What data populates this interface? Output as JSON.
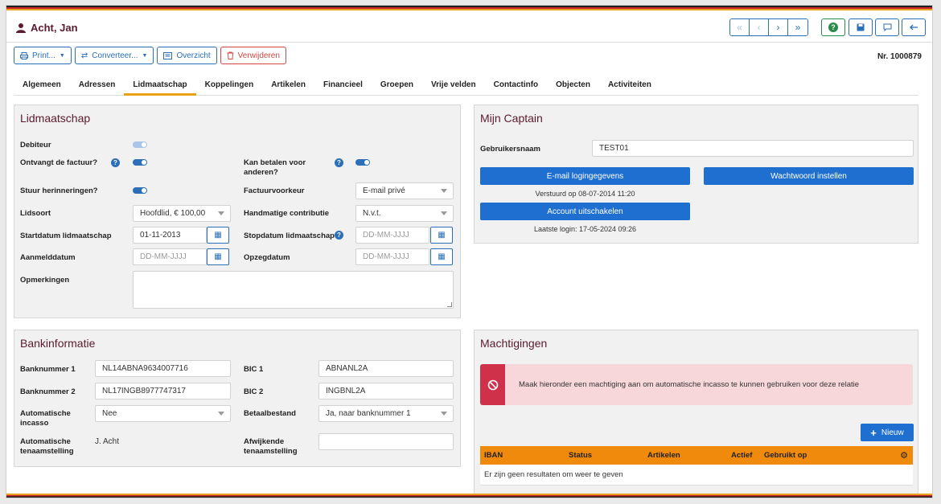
{
  "header": {
    "title": "Acht, Jan",
    "help_icon_label": "?"
  },
  "actions": {
    "print": "Print...",
    "convert": "Converteer...",
    "overview": "Overzicht",
    "delete": "Verwijderen"
  },
  "record_number": "Nr. 1000879",
  "tabs": [
    "Algemeen",
    "Adressen",
    "Lidmaatschap",
    "Koppelingen",
    "Artikelen",
    "Financieel",
    "Groepen",
    "Vrije velden",
    "Contactinfo",
    "Objecten",
    "Activiteiten"
  ],
  "active_tab": "Lidmaatschap",
  "membership": {
    "title": "Lidmaatschap",
    "debiteur": "Debiteur",
    "ontvangt_factuur": "Ontvangt de factuur?",
    "kan_betalen": "Kan betalen voor anderen?",
    "stuur_herinneringen": "Stuur herinneringen?",
    "factuurvoorkeur_label": "Factuurvoorkeur",
    "factuurvoorkeur_value": "E-mail privé",
    "lidsoort_label": "Lidsoort",
    "lidsoort_value": "Hoofdlid, € 100,00",
    "handmatige_label": "Handmatige contributie",
    "handmatige_value": "N.v.t.",
    "startdatum_label": "Startdatum lidmaatschap",
    "startdatum_value": "01-11-2013",
    "stopdatum_label": "Stopdatum lidmaatschap",
    "date_placeholder": "DD-MM-JJJJ",
    "aanmelddatum_label": "Aanmelddatum",
    "opzegdatum_label": "Opzegdatum",
    "opmerkingen_label": "Opmerkingen"
  },
  "captain": {
    "title": "Mijn Captain",
    "username_label": "Gebruikersnaam",
    "username_value": "TEST01",
    "email_btn": "E-mail logingegevens",
    "password_btn": "Wachtwoord instellen",
    "sent_text": "Verstuurd op 08-07-2014 11:20",
    "disable_btn": "Account uitschakelen",
    "last_login": "Laatste login: 17-05-2024 09:26"
  },
  "bank": {
    "title": "Bankinformatie",
    "bank1_label": "Banknummer 1",
    "bank1_value": "NL14ABNA9634007716",
    "bic1_label": "BIC 1",
    "bic1_value": "ABNANL2A",
    "bank2_label": "Banknummer 2",
    "bank2_value": "NL17INGB8977747317",
    "bic2_label": "BIC 2",
    "bic2_value": "INGBNL2A",
    "auto_incasso_label": "Automatische incasso",
    "auto_incasso_value": "Nee",
    "betaalbestand_label": "Betaalbestand",
    "betaalbestand_value": "Ja, naar banknummer 1",
    "auto_tenaam_label": "Automatische tenaamstelling",
    "auto_tenaam_value": "J. Acht",
    "afwijkende_label": "Afwijkende tenaamstelling"
  },
  "mandates": {
    "title": "Machtigingen",
    "alert": "Maak hieronder een machtiging aan om automatische incasso te kunnen gebruiken voor deze relatie",
    "new_btn": "Nieuw",
    "columns": [
      "IBAN",
      "Status",
      "Artikelen",
      "Actief",
      "Gebruikt op"
    ],
    "empty": "Er zijn geen resultaten om weer te geven"
  },
  "colors": {
    "accent": "#1f6fd1",
    "brand": "#5b1a2e",
    "tab_underline": "#e8a118",
    "table_header": "#f08a0c",
    "alert_bg": "#f8d7da"
  }
}
